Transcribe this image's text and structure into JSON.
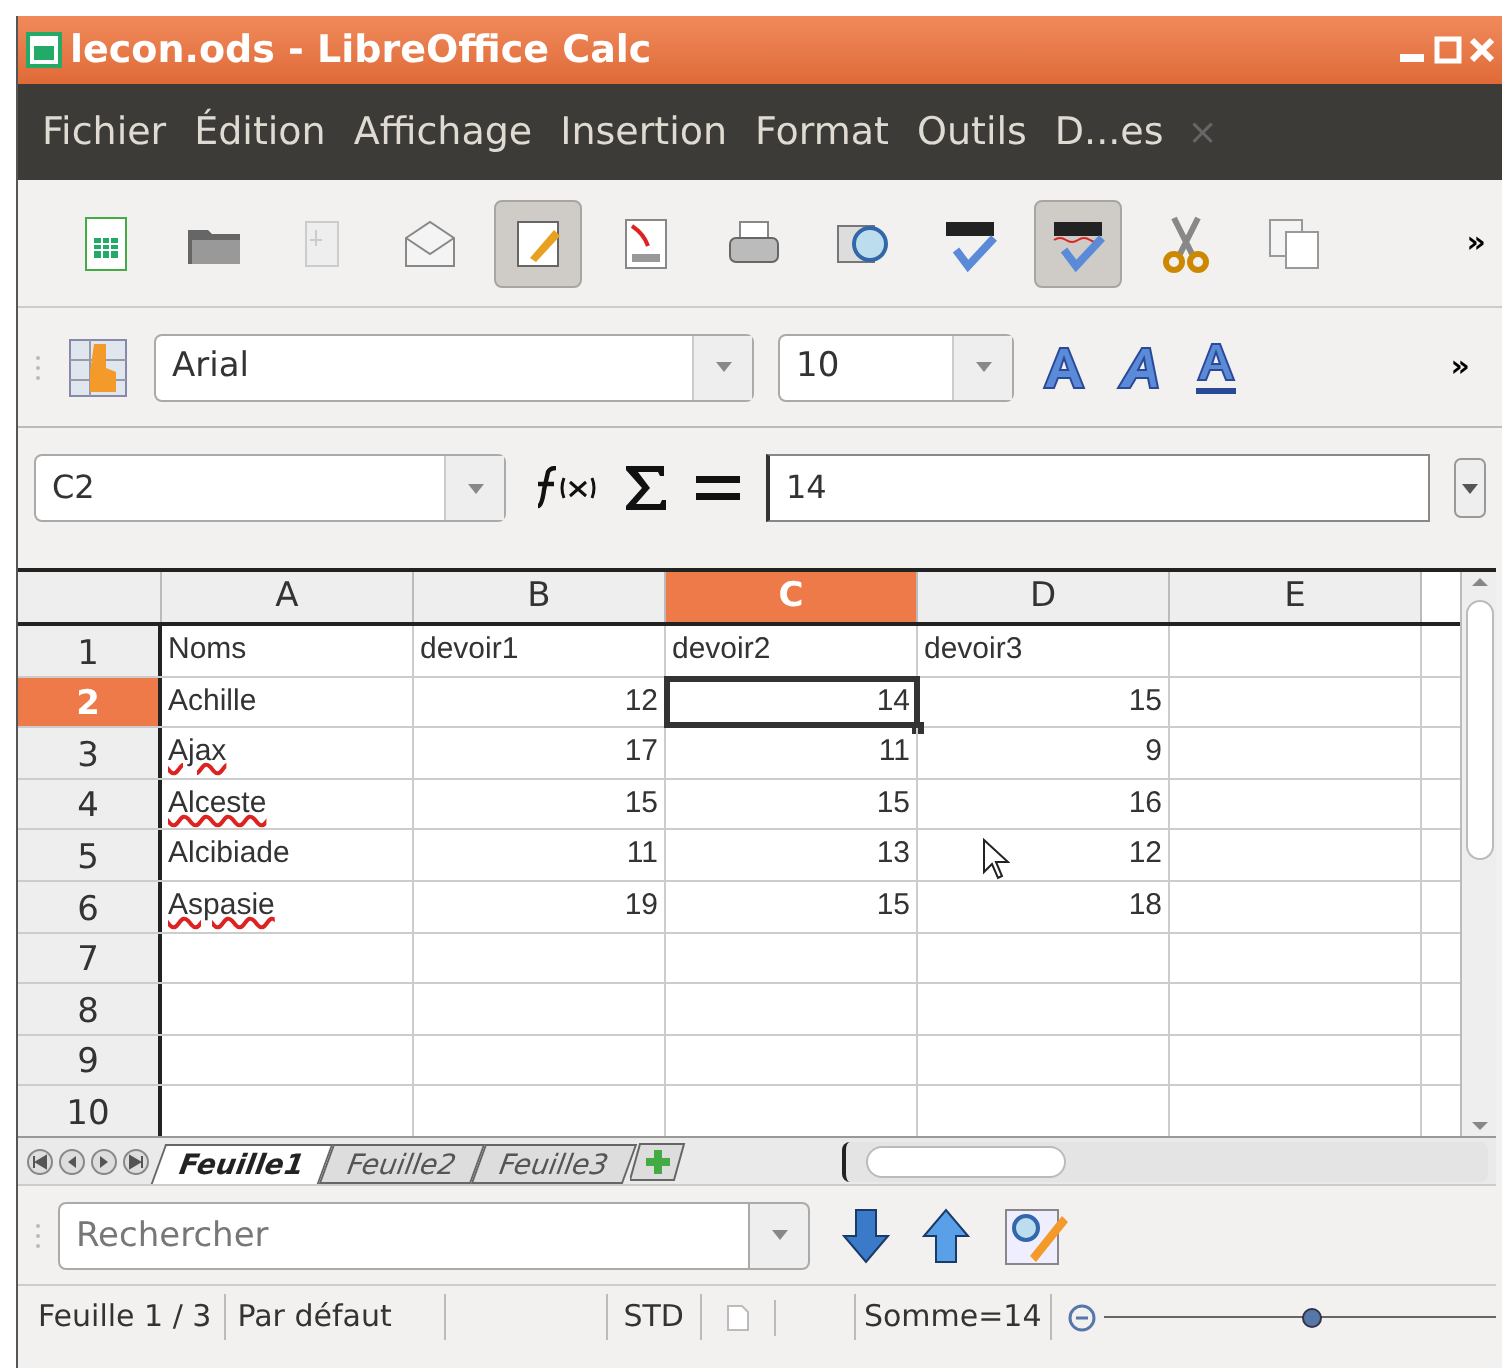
{
  "window": {
    "title": "lecon.ods - LibreOffice Calc"
  },
  "menu": [
    "Fichier",
    "Édition",
    "Affichage",
    "Insertion",
    "Format",
    "Outils",
    "D...es"
  ],
  "menu_close": "×",
  "toolbar": [
    {
      "kind": "new",
      "pressed": false
    },
    {
      "kind": "open",
      "pressed": false
    },
    {
      "kind": "save",
      "pressed": false
    },
    {
      "kind": "mail",
      "pressed": false
    },
    {
      "kind": "edit",
      "pressed": true
    },
    {
      "kind": "pdf",
      "pressed": false
    },
    {
      "kind": "print",
      "pressed": false
    },
    {
      "kind": "preview",
      "pressed": false
    },
    {
      "kind": "spell",
      "pressed": false
    },
    {
      "kind": "autospell",
      "pressed": true
    },
    {
      "kind": "cut",
      "pressed": false
    },
    {
      "kind": "copy",
      "pressed": false
    }
  ],
  "more": "»",
  "format_bar": {
    "font": "Arial",
    "size": "10",
    "more": "»"
  },
  "formula_bar": {
    "cell_ref": "C2",
    "content": "14"
  },
  "grid": {
    "columns": [
      {
        "label": "A",
        "selected": false
      },
      {
        "label": "B",
        "selected": false
      },
      {
        "label": "C",
        "selected": true
      },
      {
        "label": "D",
        "selected": false
      },
      {
        "label": "E",
        "selected": false
      }
    ],
    "rows": [
      {
        "header": "1",
        "selected": false,
        "cells": [
          "Noms",
          "devoir1",
          "devoir2",
          "devoir3"
        ]
      },
      {
        "header": "2",
        "selected": true,
        "cells": [
          "Achille",
          "12",
          "14",
          "15"
        ]
      },
      {
        "header": "3",
        "selected": false,
        "misspelled": true,
        "cells": [
          "Ajax",
          "17",
          "11",
          "9"
        ]
      },
      {
        "header": "4",
        "selected": false,
        "misspelled": true,
        "cells": [
          "Alceste",
          "15",
          "15",
          "16"
        ]
      },
      {
        "header": "5",
        "selected": false,
        "cells": [
          "Alcibiade",
          "11",
          "13",
          "12"
        ]
      },
      {
        "header": "6",
        "selected": false,
        "misspelled": true,
        "cells": [
          "Aspasie",
          "19",
          "15",
          "18"
        ]
      },
      {
        "header": "7",
        "selected": false,
        "cells": []
      },
      {
        "header": "8",
        "selected": false,
        "cells": []
      },
      {
        "header": "9",
        "selected": false,
        "cells": []
      },
      {
        "header": "10",
        "selected": false,
        "cells": []
      }
    ]
  },
  "sheets": [
    {
      "label": "Feuille1",
      "selected": true
    },
    {
      "label": "Feuille2",
      "selected": false
    },
    {
      "label": "Feuille3",
      "selected": false
    }
  ],
  "find": {
    "placeholder": "Rechercher"
  },
  "status_bar": {
    "sheet": "Feuille 1 / 3",
    "style": "Par défaut",
    "mode": "STD",
    "sum": "Somme=14",
    "zoom": {
      "level": 0.53
    }
  }
}
